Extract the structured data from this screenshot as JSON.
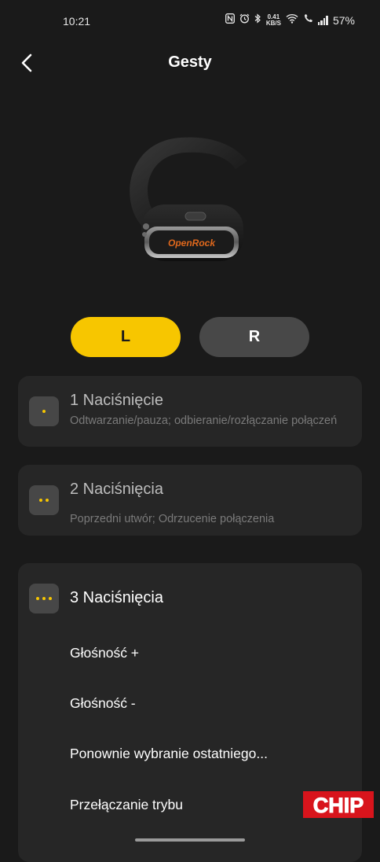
{
  "status_bar": {
    "time": "10:21",
    "speed_value": "0.41",
    "speed_unit": "KB/S",
    "battery": "57%"
  },
  "header": {
    "title": "Gesty"
  },
  "product": {
    "brand_on_image": "OpenRock"
  },
  "side_selector": {
    "left_label": "L",
    "right_label": "R",
    "selected": "L"
  },
  "gestures": [
    {
      "title": "1 Naciśnięcie",
      "description": "Odtwarzanie/pauza; odbieranie/rozłączanie połączeń"
    },
    {
      "title": "2 Naciśnięcia",
      "description": "Poprzedni utwór;  Odrzucenie połączenia"
    },
    {
      "title": "3 Naciśnięcia",
      "options": [
        "Głośność +",
        "Głośność -",
        "Ponownie wybranie ostatniego...",
        "Przełączanie trybu"
      ]
    }
  ],
  "watermark": "CHIP",
  "colors": {
    "background": "#1a1a1a",
    "card": "#262626",
    "accent": "#f7c600",
    "inactive_button": "#484848"
  }
}
